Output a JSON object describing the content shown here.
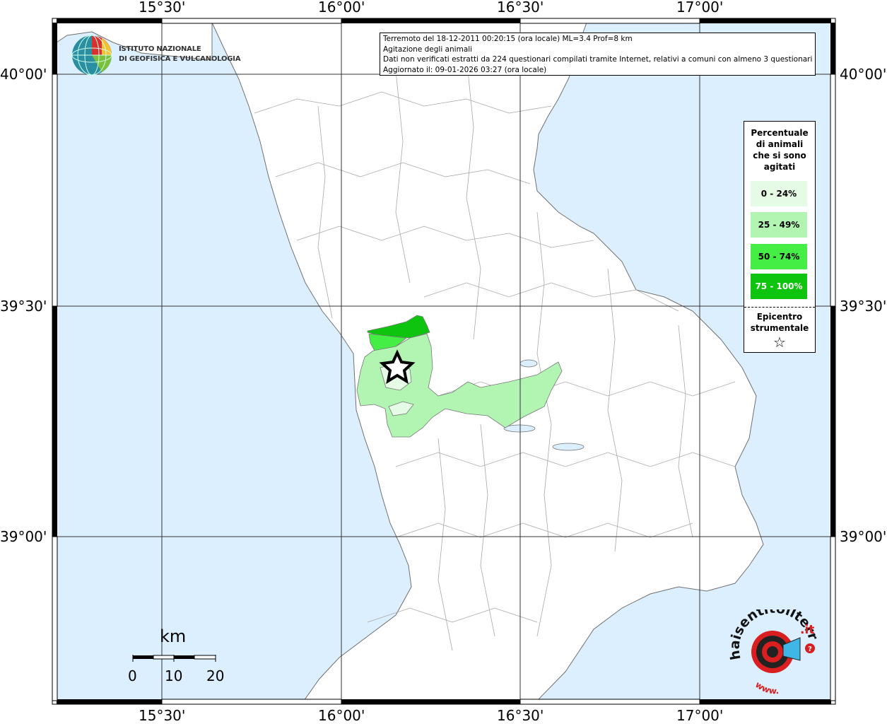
{
  "map": {
    "lon_labels": [
      "15°30'",
      "16°00'",
      "16°30'",
      "17°00'"
    ],
    "lat_labels": [
      "40°00'",
      "39°30'",
      "39°00'"
    ],
    "colors": {
      "sea": "#dcefff",
      "land": "#ffffff",
      "borders": "#9a9a9a",
      "class_0_24": "#e6fbe6",
      "class_25_49": "#b2f5b2",
      "class_50_74": "#44ee44",
      "class_75_100": "#0fc40f"
    }
  },
  "info": {
    "line1": "Terremoto del 18-12-2011 00:20:15 (ora locale) ML=3.4 Prof=8 km",
    "line2": "Agitazione degli animali",
    "line3": "Dati non verificati estratti da 224 questionari compilati tramite Internet, relativi a comuni con almeno 3 questionari.",
    "line4": "Aggiornato il: 09-01-2026 03:27 (ora locale)"
  },
  "legend": {
    "title_lines": [
      "Percentuale",
      "di animali",
      "che si sono",
      "agitati"
    ],
    "items": [
      {
        "label": "0 - 24%",
        "color": "#e6fbe6"
      },
      {
        "label": "25 - 49%",
        "color": "#b2f5b2"
      },
      {
        "label": "50 - 74%",
        "color": "#44ee44"
      },
      {
        "label": "75 - 100%",
        "color": "#0fc40f"
      }
    ],
    "epicenter_lines": [
      "Epicentro",
      "strumentale"
    ],
    "star": "☆"
  },
  "logo": {
    "line1": "ISTITUTO NAZIONALE",
    "line2": "DI GEOFISICA E VULCANOLOGIA"
  },
  "scale": {
    "unit": "km",
    "ticks": [
      "0",
      "10",
      "20"
    ]
  },
  "hsit": {
    "text_main": "haisentitoilterremoto",
    "text_it": ".it",
    "text_www": "www."
  }
}
